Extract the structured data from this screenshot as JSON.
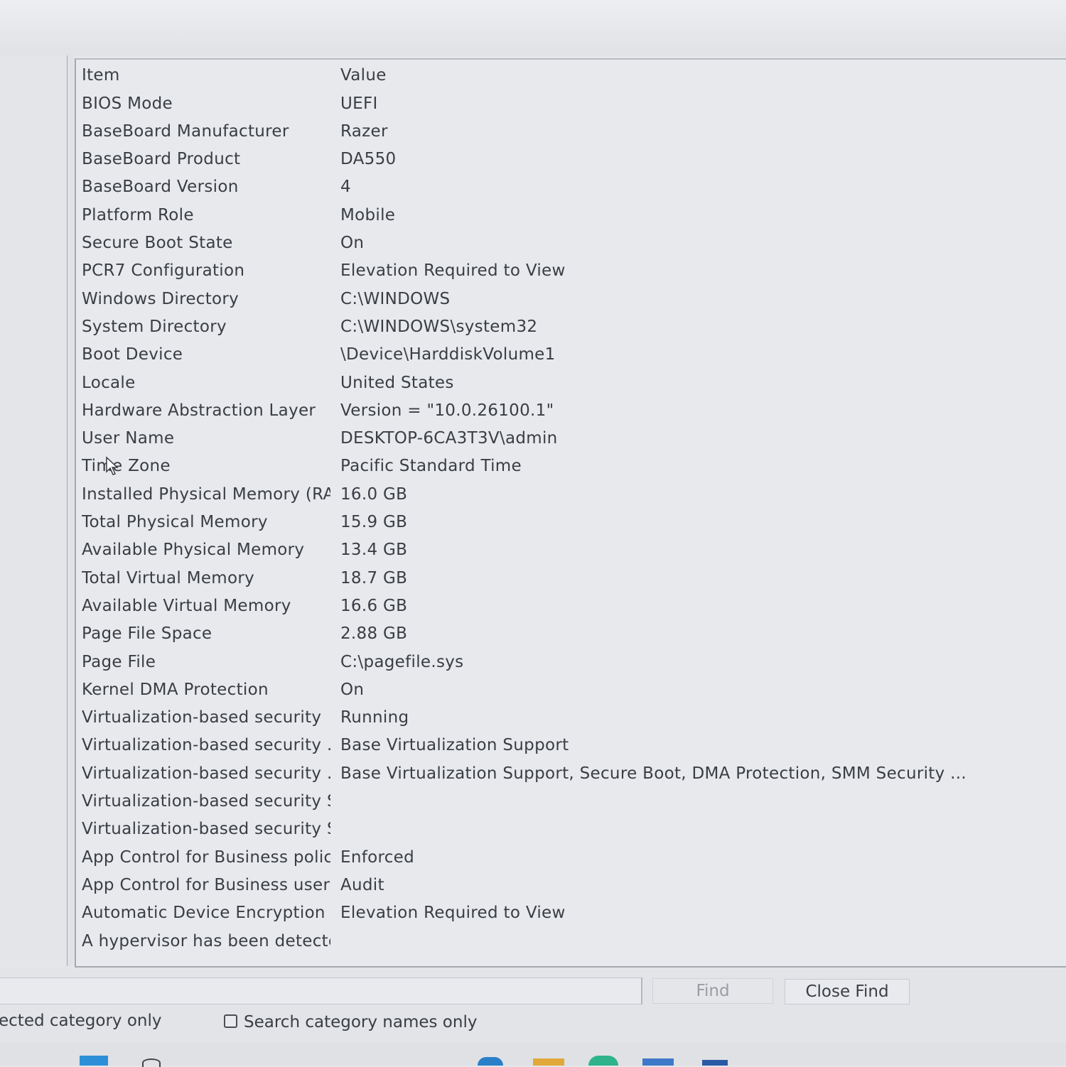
{
  "table": {
    "header": {
      "item": "Item",
      "value": "Value"
    },
    "rows": [
      {
        "item": "BIOS Mode",
        "value": "UEFI"
      },
      {
        "item": "BaseBoard Manufacturer",
        "value": "Razer"
      },
      {
        "item": "BaseBoard Product",
        "value": "DA550"
      },
      {
        "item": "BaseBoard Version",
        "value": "4"
      },
      {
        "item": "Platform Role",
        "value": "Mobile"
      },
      {
        "item": "Secure Boot State",
        "value": "On"
      },
      {
        "item": "PCR7 Configuration",
        "value": "Elevation Required to View"
      },
      {
        "item": "Windows Directory",
        "value": "C:\\WINDOWS"
      },
      {
        "item": "System Directory",
        "value": "C:\\WINDOWS\\system32"
      },
      {
        "item": "Boot Device",
        "value": "\\Device\\HarddiskVolume1"
      },
      {
        "item": "Locale",
        "value": "United States"
      },
      {
        "item": "Hardware Abstraction Layer",
        "value": "Version = \"10.0.26100.1\""
      },
      {
        "item": "User Name",
        "value": "DESKTOP-6CA3T3V\\admin"
      },
      {
        "item": "Time Zone",
        "value": "Pacific Standard Time"
      },
      {
        "item": "Installed Physical Memory (RA...",
        "value": "16.0 GB"
      },
      {
        "item": "Total Physical Memory",
        "value": "15.9 GB"
      },
      {
        "item": "Available Physical Memory",
        "value": "13.4 GB"
      },
      {
        "item": "Total Virtual Memory",
        "value": "18.7 GB"
      },
      {
        "item": "Available Virtual Memory",
        "value": "16.6 GB"
      },
      {
        "item": "Page File Space",
        "value": "2.88 GB"
      },
      {
        "item": "Page File",
        "value": "C:\\pagefile.sys"
      },
      {
        "item": "Kernel DMA Protection",
        "value": "On"
      },
      {
        "item": "Virtualization-based security",
        "value": "Running"
      },
      {
        "item": "Virtualization-based security ...",
        "value": "Base Virtualization Support"
      },
      {
        "item": "Virtualization-based security ...",
        "value": "Base Virtualization Support, Secure Boot, DMA Protection, SMM Security ..."
      },
      {
        "item": "Virtualization-based security S...",
        "value": ""
      },
      {
        "item": "Virtualization-based security S...",
        "value": ""
      },
      {
        "item": "App Control for Business policy",
        "value": "Enforced"
      },
      {
        "item": "App Control for Business user ...",
        "value": "Audit"
      },
      {
        "item": "Automatic Device Encryption ...",
        "value": "Elevation Required to View"
      },
      {
        "item": "A hypervisor has been detecte...",
        "value": ""
      }
    ]
  },
  "find_bar": {
    "find_input_value": "",
    "find_label": "Find",
    "close_find_label": "Close Find",
    "selected_category_label": "ected category only",
    "search_names_label": "Search category names only",
    "search_names_checked": false
  },
  "icons": {
    "cursor": "mouse-pointer-icon",
    "checkbox": "checkbox-icon"
  },
  "colors": {
    "panel_bg": "#e7e9ed",
    "text": "#3a3d44",
    "disabled_text": "#9a9ca2"
  }
}
